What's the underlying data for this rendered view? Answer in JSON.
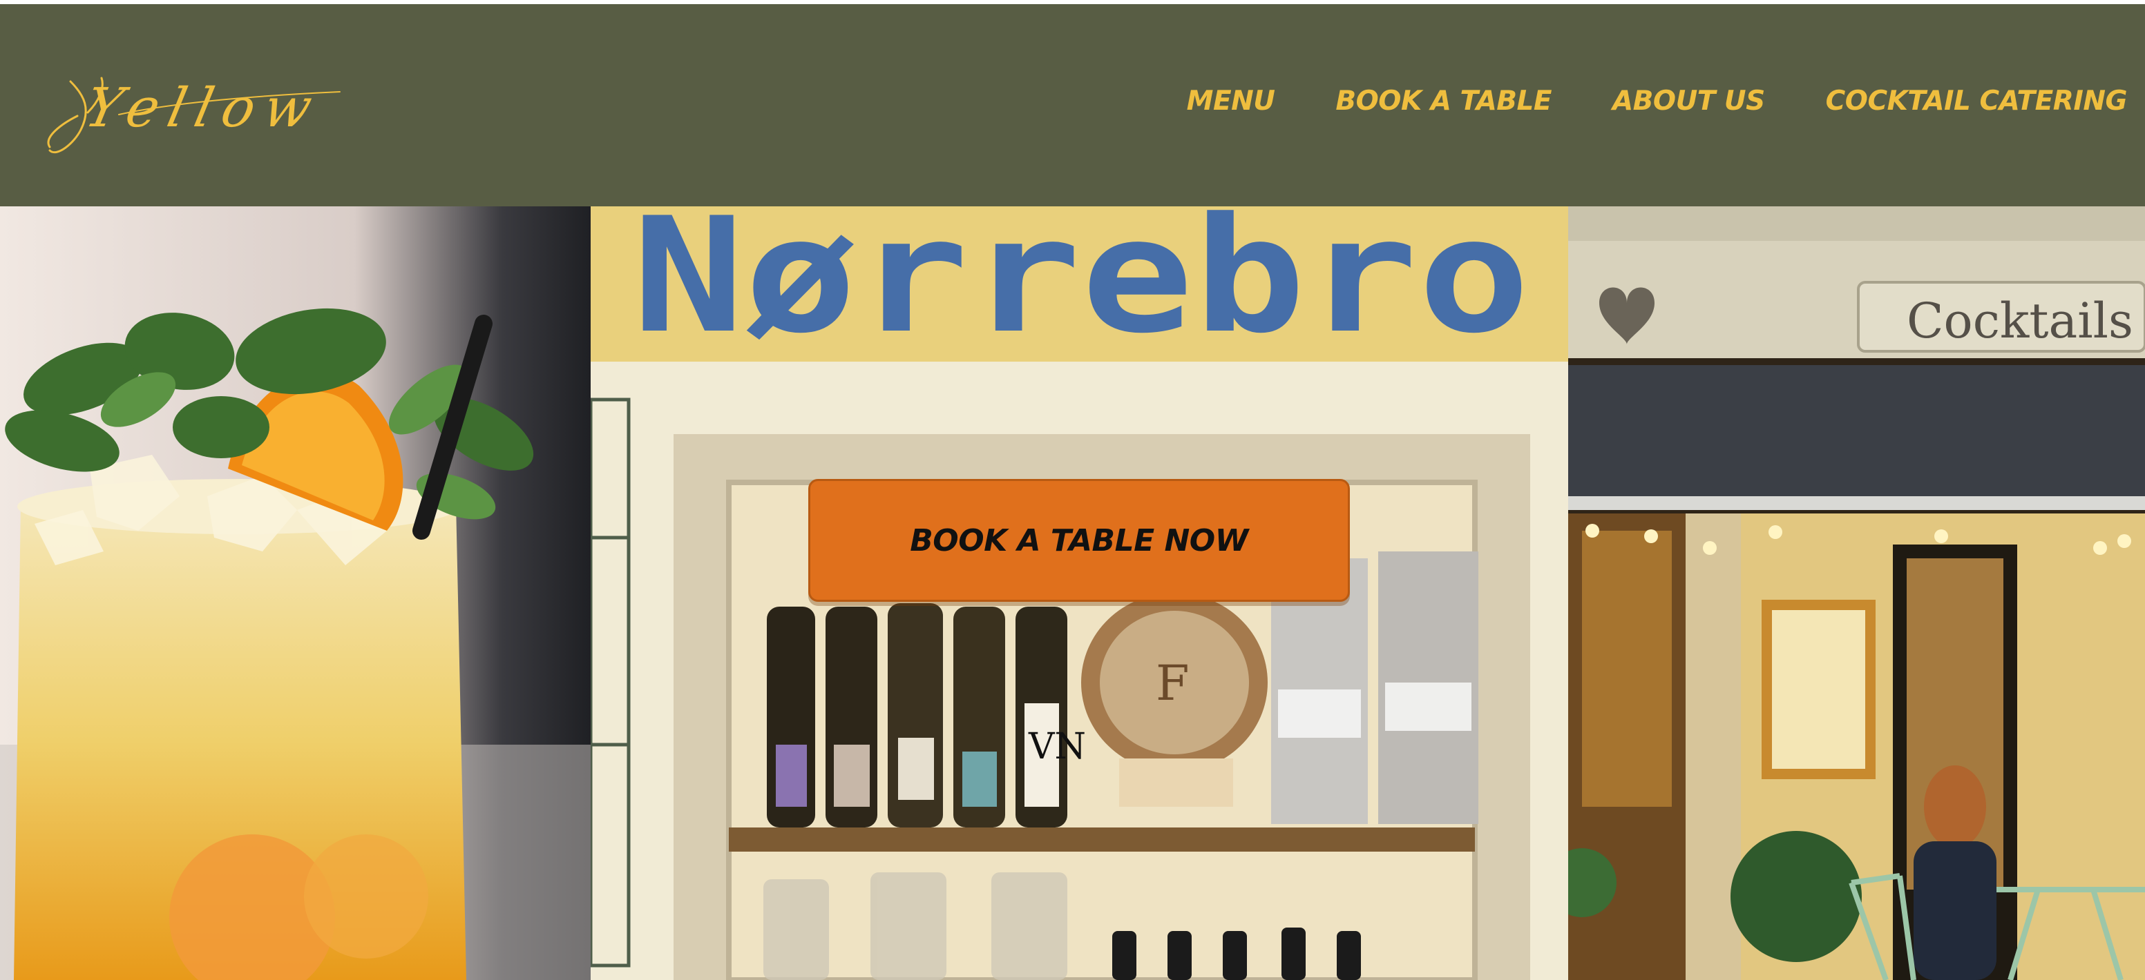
{
  "brand": {
    "logo_text": "Yellow"
  },
  "nav": {
    "items": [
      {
        "label": "MENU"
      },
      {
        "label": "BOOK A TABLE"
      },
      {
        "label": "ABOUT US"
      },
      {
        "label": "COCKTAIL CATERING"
      }
    ]
  },
  "hero": {
    "cta_label": "BOOK A TABLE NOW",
    "sign_text": "Nørrebro",
    "storefront_sign": "Cocktails"
  },
  "colors": {
    "header_bg": "#585d44",
    "nav_text": "#efbe3e",
    "cta_bg": "#e0701c",
    "cta_text": "#111111"
  }
}
